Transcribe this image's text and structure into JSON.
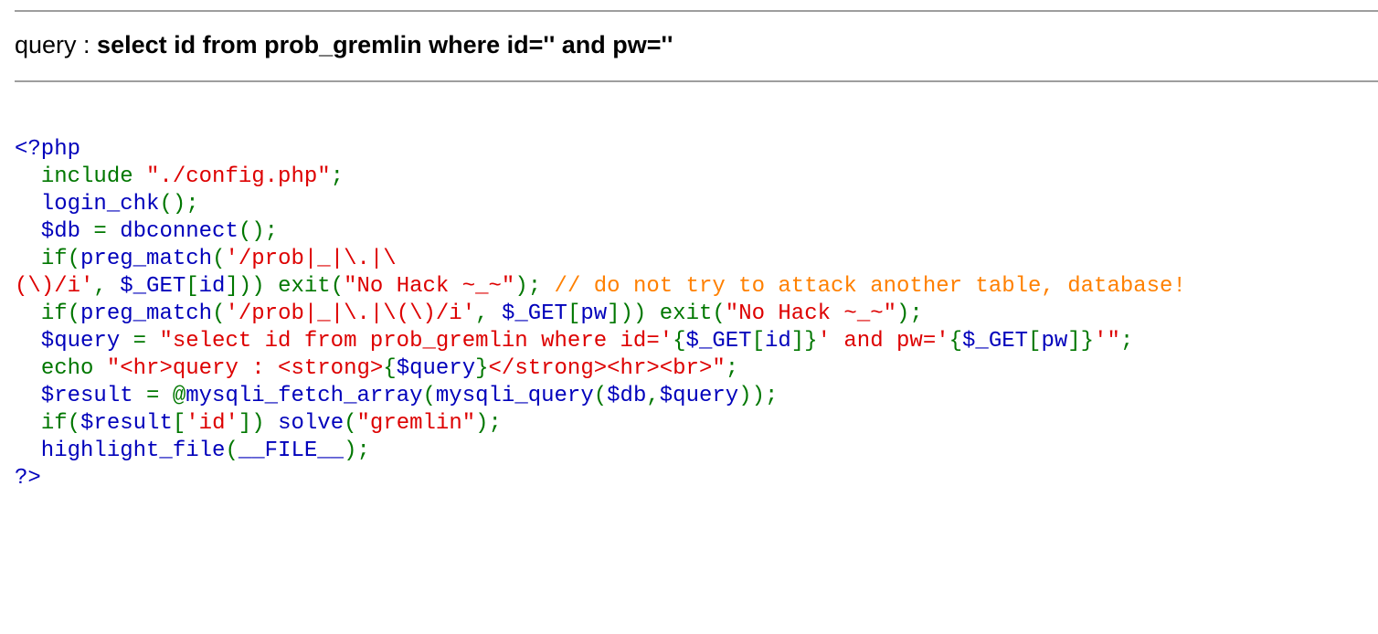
{
  "query": {
    "label": "query : ",
    "value": "select id from prob_gremlin where id='' and pw=''"
  },
  "colors": {
    "default": "#0000BB",
    "keyword": "#007700",
    "string": "#DD0000",
    "comment": "#FF8000",
    "rule": "#9e9e9e"
  },
  "source_code": {
    "lines": [
      [
        {
          "t": "default",
          "s": "<?php"
        }
      ],
      [
        {
          "t": "default",
          "s": "  "
        },
        {
          "t": "keyword",
          "s": "include "
        },
        {
          "t": "string",
          "s": "\"./config.php\""
        },
        {
          "t": "keyword",
          "s": ";"
        }
      ],
      [
        {
          "t": "default",
          "s": "  login_chk"
        },
        {
          "t": "keyword",
          "s": "();"
        }
      ],
      [
        {
          "t": "default",
          "s": "  $db "
        },
        {
          "t": "keyword",
          "s": "= "
        },
        {
          "t": "default",
          "s": "dbconnect"
        },
        {
          "t": "keyword",
          "s": "();"
        }
      ],
      [
        {
          "t": "default",
          "s": "  "
        },
        {
          "t": "keyword",
          "s": "if("
        },
        {
          "t": "default",
          "s": "preg_match"
        },
        {
          "t": "keyword",
          "s": "("
        },
        {
          "t": "string",
          "s": "'/prob|_|\\.|\\"
        }
      ],
      [
        {
          "t": "string",
          "s": "(\\)/i'"
        },
        {
          "t": "keyword",
          "s": ", "
        },
        {
          "t": "default",
          "s": "$_GET"
        },
        {
          "t": "keyword",
          "s": "["
        },
        {
          "t": "default",
          "s": "id"
        },
        {
          "t": "keyword",
          "s": "])) exit("
        },
        {
          "t": "string",
          "s": "\"No Hack ~_~\""
        },
        {
          "t": "keyword",
          "s": "); "
        },
        {
          "t": "comment",
          "s": "// do not try to attack another table, database!"
        }
      ],
      [
        {
          "t": "default",
          "s": "  "
        },
        {
          "t": "keyword",
          "s": "if("
        },
        {
          "t": "default",
          "s": "preg_match"
        },
        {
          "t": "keyword",
          "s": "("
        },
        {
          "t": "string",
          "s": "'/prob|_|\\.|\\(\\)/i'"
        },
        {
          "t": "keyword",
          "s": ", "
        },
        {
          "t": "default",
          "s": "$_GET"
        },
        {
          "t": "keyword",
          "s": "["
        },
        {
          "t": "default",
          "s": "pw"
        },
        {
          "t": "keyword",
          "s": "])) exit("
        },
        {
          "t": "string",
          "s": "\"No Hack ~_~\""
        },
        {
          "t": "keyword",
          "s": ");"
        }
      ],
      [
        {
          "t": "default",
          "s": "  $query "
        },
        {
          "t": "keyword",
          "s": "= "
        },
        {
          "t": "string",
          "s": "\"select id from prob_gremlin where id='"
        },
        {
          "t": "keyword",
          "s": "{"
        },
        {
          "t": "default",
          "s": "$_GET"
        },
        {
          "t": "keyword",
          "s": "["
        },
        {
          "t": "default",
          "s": "id"
        },
        {
          "t": "keyword",
          "s": "]}"
        },
        {
          "t": "string",
          "s": "' and pw='"
        },
        {
          "t": "keyword",
          "s": "{"
        },
        {
          "t": "default",
          "s": "$_GET"
        },
        {
          "t": "keyword",
          "s": "["
        },
        {
          "t": "default",
          "s": "pw"
        },
        {
          "t": "keyword",
          "s": "]}"
        },
        {
          "t": "string",
          "s": "'\""
        },
        {
          "t": "keyword",
          "s": ";"
        }
      ],
      [
        {
          "t": "default",
          "s": "  "
        },
        {
          "t": "keyword",
          "s": "echo "
        },
        {
          "t": "string",
          "s": "\"<hr>query : <strong>"
        },
        {
          "t": "keyword",
          "s": "{"
        },
        {
          "t": "default",
          "s": "$query"
        },
        {
          "t": "keyword",
          "s": "}"
        },
        {
          "t": "string",
          "s": "</strong><hr><br>\""
        },
        {
          "t": "keyword",
          "s": ";"
        }
      ],
      [
        {
          "t": "default",
          "s": "  $result "
        },
        {
          "t": "keyword",
          "s": "= @"
        },
        {
          "t": "default",
          "s": "mysqli_fetch_array"
        },
        {
          "t": "keyword",
          "s": "("
        },
        {
          "t": "default",
          "s": "mysqli_query"
        },
        {
          "t": "keyword",
          "s": "("
        },
        {
          "t": "default",
          "s": "$db"
        },
        {
          "t": "keyword",
          "s": ","
        },
        {
          "t": "default",
          "s": "$query"
        },
        {
          "t": "keyword",
          "s": "));"
        }
      ],
      [
        {
          "t": "default",
          "s": "  "
        },
        {
          "t": "keyword",
          "s": "if("
        },
        {
          "t": "default",
          "s": "$result"
        },
        {
          "t": "keyword",
          "s": "["
        },
        {
          "t": "string",
          "s": "'id'"
        },
        {
          "t": "keyword",
          "s": "]) "
        },
        {
          "t": "default",
          "s": "solve"
        },
        {
          "t": "keyword",
          "s": "("
        },
        {
          "t": "string",
          "s": "\"gremlin\""
        },
        {
          "t": "keyword",
          "s": ");"
        }
      ],
      [
        {
          "t": "default",
          "s": "  highlight_file"
        },
        {
          "t": "keyword",
          "s": "("
        },
        {
          "t": "default",
          "s": "__FILE__"
        },
        {
          "t": "keyword",
          "s": ");"
        }
      ],
      [
        {
          "t": "default",
          "s": "?>"
        }
      ]
    ]
  }
}
